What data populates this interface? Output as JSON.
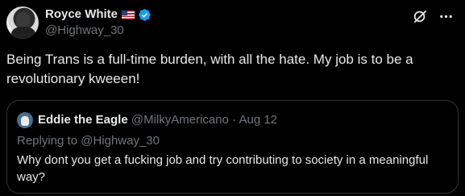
{
  "tweet": {
    "author_name": "Royce White",
    "author_handle": "@Highway_30",
    "text": "Being Trans is a full-time burden, with all the hate. My job is to be a revolutionary kweeen!"
  },
  "icons": {
    "flag": "us-flag-icon",
    "verified": "verified-badge-icon",
    "grok": "grok-icon",
    "more": "more-icon"
  },
  "quote": {
    "author_name": "Eddie the Eagle",
    "author_handle": "@MilkyAmericano",
    "separator": "·",
    "date": "Aug 12",
    "replying_to": "Replying to @Highway_30",
    "text": "Why dont you get a fucking job and try contributing to society in a meaningful way?"
  },
  "colors": {
    "background": "#000000",
    "primary_text": "#e7e9ea",
    "secondary_text": "#71767b",
    "verified_blue": "#1d9bf0",
    "border": "#2f3336"
  }
}
